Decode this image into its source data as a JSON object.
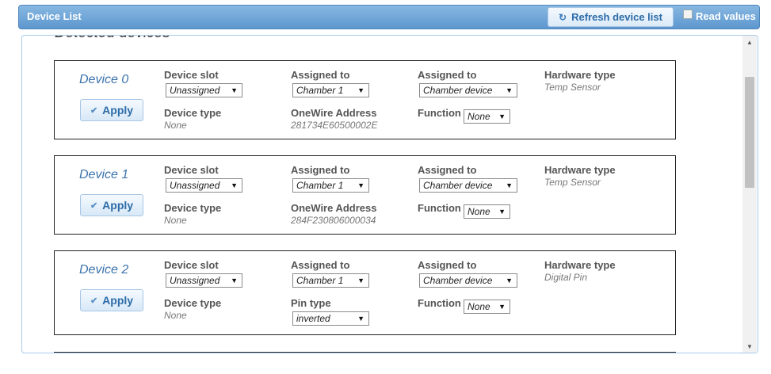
{
  "header": {
    "title": "Device List",
    "refresh_label": "Refresh device list",
    "refresh_icon": "refresh-icon",
    "read_values_label": "Read values",
    "read_values_checked": false
  },
  "section": {
    "title": "Detected devices"
  },
  "labels": {
    "device_slot": "Device slot",
    "assigned_to": "Assigned to",
    "hardware_type": "Hardware type",
    "device_type": "Device type",
    "onewire_address": "OneWire Address",
    "pin_type": "Pin type",
    "function": "Function",
    "apply": "Apply"
  },
  "devices": [
    {
      "name": "Device 0",
      "device_slot": "Unassigned",
      "assigned_chamber": "Chamber 1",
      "assigned_device": "Chamber device",
      "hardware_type": "Temp Sensor",
      "device_type": "None",
      "onewire_address": "281734E60500002E",
      "function": "None"
    },
    {
      "name": "Device 1",
      "device_slot": "Unassigned",
      "assigned_chamber": "Chamber 1",
      "assigned_device": "Chamber device",
      "hardware_type": "Temp Sensor",
      "device_type": "None",
      "onewire_address": "284F230806000034",
      "function": "None"
    },
    {
      "name": "Device 2",
      "device_slot": "Unassigned",
      "assigned_chamber": "Chamber 1",
      "assigned_device": "Chamber device",
      "hardware_type": "Digital Pin",
      "device_type": "None",
      "pin_type": "inverted",
      "function": "None"
    }
  ],
  "colors": {
    "header_bg": "#6fa6d8",
    "button_text": "#2d6ca8",
    "device_name": "#3b73ad"
  }
}
